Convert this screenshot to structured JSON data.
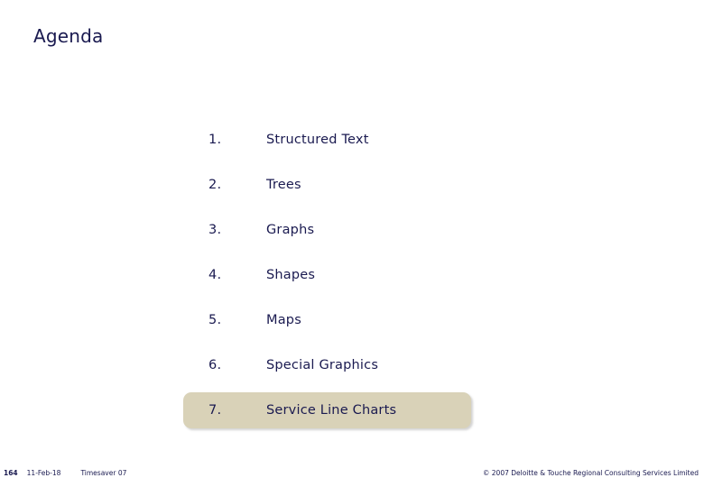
{
  "slide": {
    "title": "Agenda",
    "colors": {
      "text": "#1a1a50",
      "highlight_fill": "#d9d2b8",
      "background": "#ffffff"
    }
  },
  "agenda": {
    "items": [
      {
        "number": "1.",
        "label": "Structured Text",
        "highlighted": false
      },
      {
        "number": "2.",
        "label": "Trees",
        "highlighted": false
      },
      {
        "number": "3.",
        "label": "Graphs",
        "highlighted": false
      },
      {
        "number": "4.",
        "label": "Shapes",
        "highlighted": false
      },
      {
        "number": "5.",
        "label": "Maps",
        "highlighted": false
      },
      {
        "number": "6.",
        "label": "Special Graphics",
        "highlighted": false
      },
      {
        "number": "7.",
        "label": "Service Line Charts",
        "highlighted": true
      }
    ]
  },
  "footer": {
    "page_number": "164",
    "date": "11-Feb-18",
    "deck_name": "Timesaver 07",
    "copyright": "© 2007 Deloitte & Touche Regional Consulting Services Limited"
  }
}
